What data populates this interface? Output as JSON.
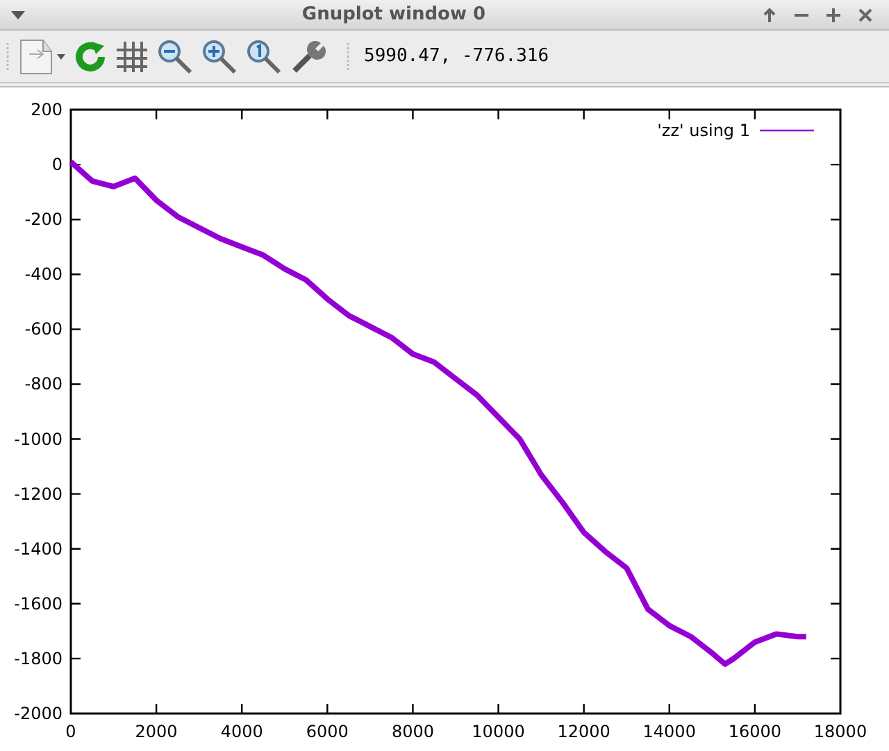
{
  "window": {
    "title": "Gnuplot window 0"
  },
  "toolbar": {
    "coordinates": "5990.47, -776.316"
  },
  "plot": {
    "chart_data": {
      "type": "line",
      "x": [
        0,
        500,
        1000,
        1500,
        2000,
        2500,
        3000,
        3500,
        4000,
        4500,
        5000,
        5500,
        6000,
        6500,
        7000,
        7500,
        8000,
        8500,
        9000,
        9500,
        10000,
        10500,
        11000,
        11500,
        12000,
        12500,
        13000,
        13500,
        14000,
        14500,
        15000,
        15300,
        15500,
        16000,
        16500,
        17000,
        17200
      ],
      "series": [
        {
          "name": "'zz' using 1",
          "color": "#9400d3",
          "values": [
            10,
            -60,
            -80,
            -50,
            -130,
            -190,
            -230,
            -270,
            -300,
            -330,
            -380,
            -420,
            -490,
            -550,
            -590,
            -630,
            -690,
            -720,
            -780,
            -840,
            -920,
            -1000,
            -1130,
            -1230,
            -1340,
            -1410,
            -1470,
            -1620,
            -1680,
            -1720,
            -1780,
            -1820,
            -1800,
            -1740,
            -1710,
            -1720,
            -1720
          ]
        }
      ],
      "xlim": [
        0,
        18000
      ],
      "ylim": [
        -2000,
        200
      ],
      "xticks": [
        0,
        2000,
        4000,
        6000,
        8000,
        10000,
        12000,
        14000,
        16000,
        18000
      ],
      "yticks": [
        200,
        0,
        -200,
        -400,
        -600,
        -800,
        -1000,
        -1200,
        -1400,
        -1600,
        -1800,
        -2000
      ]
    }
  }
}
